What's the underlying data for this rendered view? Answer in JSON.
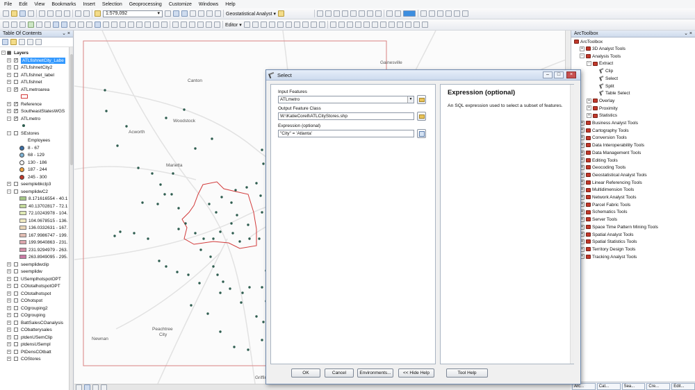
{
  "menu": [
    "File",
    "Edit",
    "View",
    "Bookmarks",
    "Insert",
    "Selection",
    "Geoprocessing",
    "Customize",
    "Windows",
    "Help"
  ],
  "toolbar": {
    "scale": "1:579,092",
    "geostat_label": "Geostatistical Analyst ▾",
    "editor_label": "Editor ▾"
  },
  "toc": {
    "title": "Table Of Contents",
    "pin": "⌄ ×",
    "layers_label": "Layers",
    "items": [
      {
        "name": "ATLfishnetCity_Labe",
        "expand": "+",
        "check": true,
        "selected": true
      },
      {
        "name": "ATLfishnetCity2",
        "expand": "+",
        "check": false
      },
      {
        "name": "ATLfishnet_label",
        "expand": "+",
        "check": false
      },
      {
        "name": "ATLfishnet",
        "expand": "+",
        "check": false
      },
      {
        "name": "ATLmetroarea",
        "expand": "−",
        "check": true
      },
      {
        "name": "Reference",
        "expand": "+",
        "check": true
      },
      {
        "name": "SoutheastStatesWGS",
        "expand": "+",
        "check": true
      },
      {
        "name": "ATLmetro",
        "expand": "−",
        "check": true
      },
      {
        "name": "SEstores",
        "expand": "−",
        "check": false
      }
    ],
    "employees_label": "Employees",
    "employee_classes": [
      {
        "label": "8 - 67",
        "color": "#3a6ea5"
      },
      {
        "label": "68 - 129",
        "color": "#7fb3d5"
      },
      {
        "label": "130 - 186",
        "color": "#f7f7f7"
      },
      {
        "label": "187 - 244",
        "color": "#f1a340"
      },
      {
        "label": "245 - 300",
        "color": "#c0392b"
      }
    ],
    "items2": [
      {
        "name": "seemplebkclp3",
        "expand": "+",
        "check": false
      },
      {
        "name": "seemplidwC2",
        "expand": "−",
        "check": false
      }
    ],
    "raster_classes": [
      {
        "label": "8.171616554 - 40.1",
        "color": "#a6c886"
      },
      {
        "label": "40.13702817 - 72.1",
        "color": "#c2d99a"
      },
      {
        "label": "72.10243978 - 104.",
        "color": "#dfe9b4"
      },
      {
        "label": "104.0678515 - 136.",
        "color": "#efe9c0"
      },
      {
        "label": "136.0332631 - 167.",
        "color": "#e9d6b8"
      },
      {
        "label": "167.9986747 - 199.",
        "color": "#e2bdb3"
      },
      {
        "label": "199.9640863 - 231.",
        "color": "#dba6ad"
      },
      {
        "label": "231.9294979 - 263.",
        "color": "#d38fa8"
      },
      {
        "label": "263.8949095 - 295.",
        "color": "#c979a4"
      }
    ],
    "items3": [
      {
        "name": "seemplidwclip"
      },
      {
        "name": "seemplidw"
      },
      {
        "name": "USemplhotspotOPT"
      },
      {
        "name": "COtotalhotspotOPT"
      },
      {
        "name": "COtotalhotspot"
      },
      {
        "name": "COhotspot"
      },
      {
        "name": "COgrouping2"
      },
      {
        "name": "COgrouping"
      },
      {
        "name": "BattSalesCOanalysis"
      },
      {
        "name": "CObatterysales"
      },
      {
        "name": "ptdenUSemClip"
      },
      {
        "name": "ptdensUSempl"
      },
      {
        "name": "PtDensCOtbatt"
      },
      {
        "name": "COStores"
      }
    ]
  },
  "map": {
    "cities": [
      {
        "name": "Gainesville"
      },
      {
        "name": "Canton"
      },
      {
        "name": "Woodstock"
      },
      {
        "name": "Acworth"
      },
      {
        "name": "Marietta"
      },
      {
        "name": "Peachtree City"
      },
      {
        "name": "Newnan"
      },
      {
        "name": "Griffin"
      }
    ]
  },
  "toolbox": {
    "title": "ArcToolbox",
    "pin": "⌄ ×",
    "root": "ArcToolbox",
    "items": [
      {
        "label": "3D Analyst Tools",
        "level": 1,
        "type": "box",
        "expand": "+"
      },
      {
        "label": "Analysis Tools",
        "level": 1,
        "type": "box",
        "expand": "−"
      },
      {
        "label": "Extract",
        "level": 2,
        "type": "box",
        "expand": "−"
      },
      {
        "label": "Clip",
        "level": 3,
        "type": "tool"
      },
      {
        "label": "Select",
        "level": 3,
        "type": "tool"
      },
      {
        "label": "Split",
        "level": 3,
        "type": "tool"
      },
      {
        "label": "Table Select",
        "level": 3,
        "type": "tool"
      },
      {
        "label": "Overlay",
        "level": 2,
        "type": "box",
        "expand": "+"
      },
      {
        "label": "Proximity",
        "level": 2,
        "type": "box",
        "expand": "+"
      },
      {
        "label": "Statistics",
        "level": 2,
        "type": "box",
        "expand": "+"
      },
      {
        "label": "Business Analyst Tools",
        "level": 1,
        "type": "box",
        "expand": "+"
      },
      {
        "label": "Cartography Tools",
        "level": 1,
        "type": "box",
        "expand": "+"
      },
      {
        "label": "Conversion Tools",
        "level": 1,
        "type": "box",
        "expand": "+"
      },
      {
        "label": "Data Interoperability Tools",
        "level": 1,
        "type": "box",
        "expand": "+"
      },
      {
        "label": "Data Management Tools",
        "level": 1,
        "type": "box",
        "expand": "+"
      },
      {
        "label": "Editing Tools",
        "level": 1,
        "type": "box",
        "expand": "+"
      },
      {
        "label": "Geocoding Tools",
        "level": 1,
        "type": "box",
        "expand": "+"
      },
      {
        "label": "Geostatistical Analyst Tools",
        "level": 1,
        "type": "box",
        "expand": "+"
      },
      {
        "label": "Linear Referencing Tools",
        "level": 1,
        "type": "box",
        "expand": "+"
      },
      {
        "label": "Multidimension Tools",
        "level": 1,
        "type": "box",
        "expand": "+"
      },
      {
        "label": "Network Analyst Tools",
        "level": 1,
        "type": "box",
        "expand": "+"
      },
      {
        "label": "Parcel Fabric Tools",
        "level": 1,
        "type": "box",
        "expand": "+"
      },
      {
        "label": "Schematics Tools",
        "level": 1,
        "type": "box",
        "expand": "+"
      },
      {
        "label": "Server Tools",
        "level": 1,
        "type": "box",
        "expand": "+"
      },
      {
        "label": "Space Time Pattern Mining Tools",
        "level": 1,
        "type": "box",
        "expand": "+"
      },
      {
        "label": "Spatial Analyst Tools",
        "level": 1,
        "type": "box",
        "expand": "+"
      },
      {
        "label": "Spatial Statistics Tools",
        "level": 1,
        "type": "box",
        "expand": "+"
      },
      {
        "label": "Territory Design Tools",
        "level": 1,
        "type": "box",
        "expand": "+"
      },
      {
        "label": "Tracking Analyst Tools",
        "level": 1,
        "type": "box",
        "expand": "+"
      }
    ],
    "tabs": [
      "Arc...",
      "Cat...",
      "Sea...",
      "Cre...",
      "Edit..."
    ]
  },
  "dialog": {
    "title": "Select",
    "input_features_label": "Input Features",
    "input_features_value": "ATLmetro",
    "output_label": "Output Feature Class",
    "output_value": "W:\\KatieCorell\\ATLCityStores.shp",
    "expression_label": "Expression (optional)",
    "expression_value": "\"City\" = 'Atlanta'",
    "help_title": "Expression (optional)",
    "help_text": "An SQL expression used to select a subset of features.",
    "buttons": {
      "ok": "OK",
      "cancel": "Cancel",
      "env": "Environments...",
      "hide_help": "<< Hide Help",
      "tool_help": "Tool Help"
    },
    "win_min": "–",
    "win_max": "□",
    "win_close": "×"
  }
}
